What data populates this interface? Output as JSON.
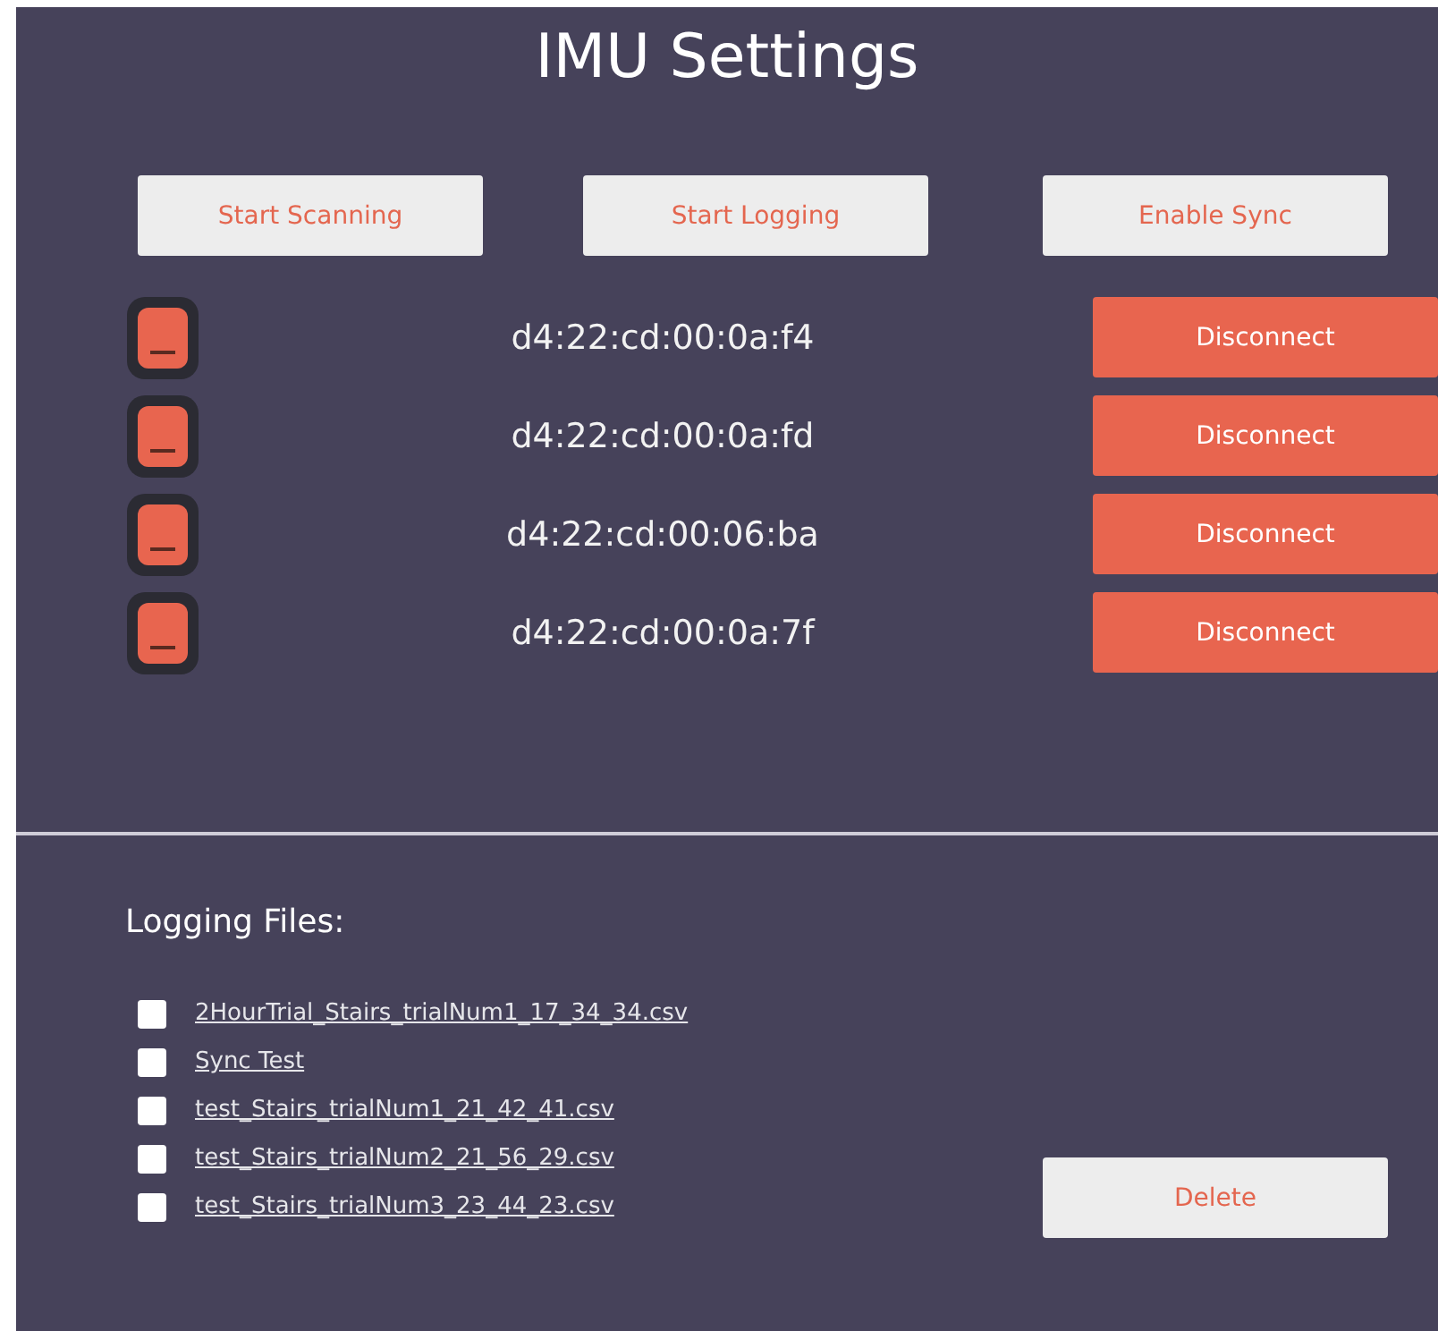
{
  "title": "IMU Settings",
  "actions": [
    "Start Scanning",
    "Start Logging",
    "Enable Sync"
  ],
  "devices": [
    {
      "address": "d4:22:cd:00:0a:f4",
      "button": "Disconnect"
    },
    {
      "address": "d4:22:cd:00:0a:fd",
      "button": "Disconnect"
    },
    {
      "address": "d4:22:cd:00:06:ba",
      "button": "Disconnect"
    },
    {
      "address": "d4:22:cd:00:0a:7f",
      "button": "Disconnect"
    }
  ],
  "logging": {
    "heading": "Logging Files:",
    "delete_button": "Delete",
    "files": [
      {
        "name": "2HourTrial_Stairs_trialNum1_17_34_34.csv",
        "checked": false
      },
      {
        "name": "Sync Test",
        "checked": false
      },
      {
        "name": "test_Stairs_trialNum1_21_42_41.csv",
        "checked": false
      },
      {
        "name": "test_Stairs_trialNum2_21_56_29.csv",
        "checked": false
      },
      {
        "name": "test_Stairs_trialNum3_23_44_23.csv",
        "checked": false
      }
    ]
  }
}
